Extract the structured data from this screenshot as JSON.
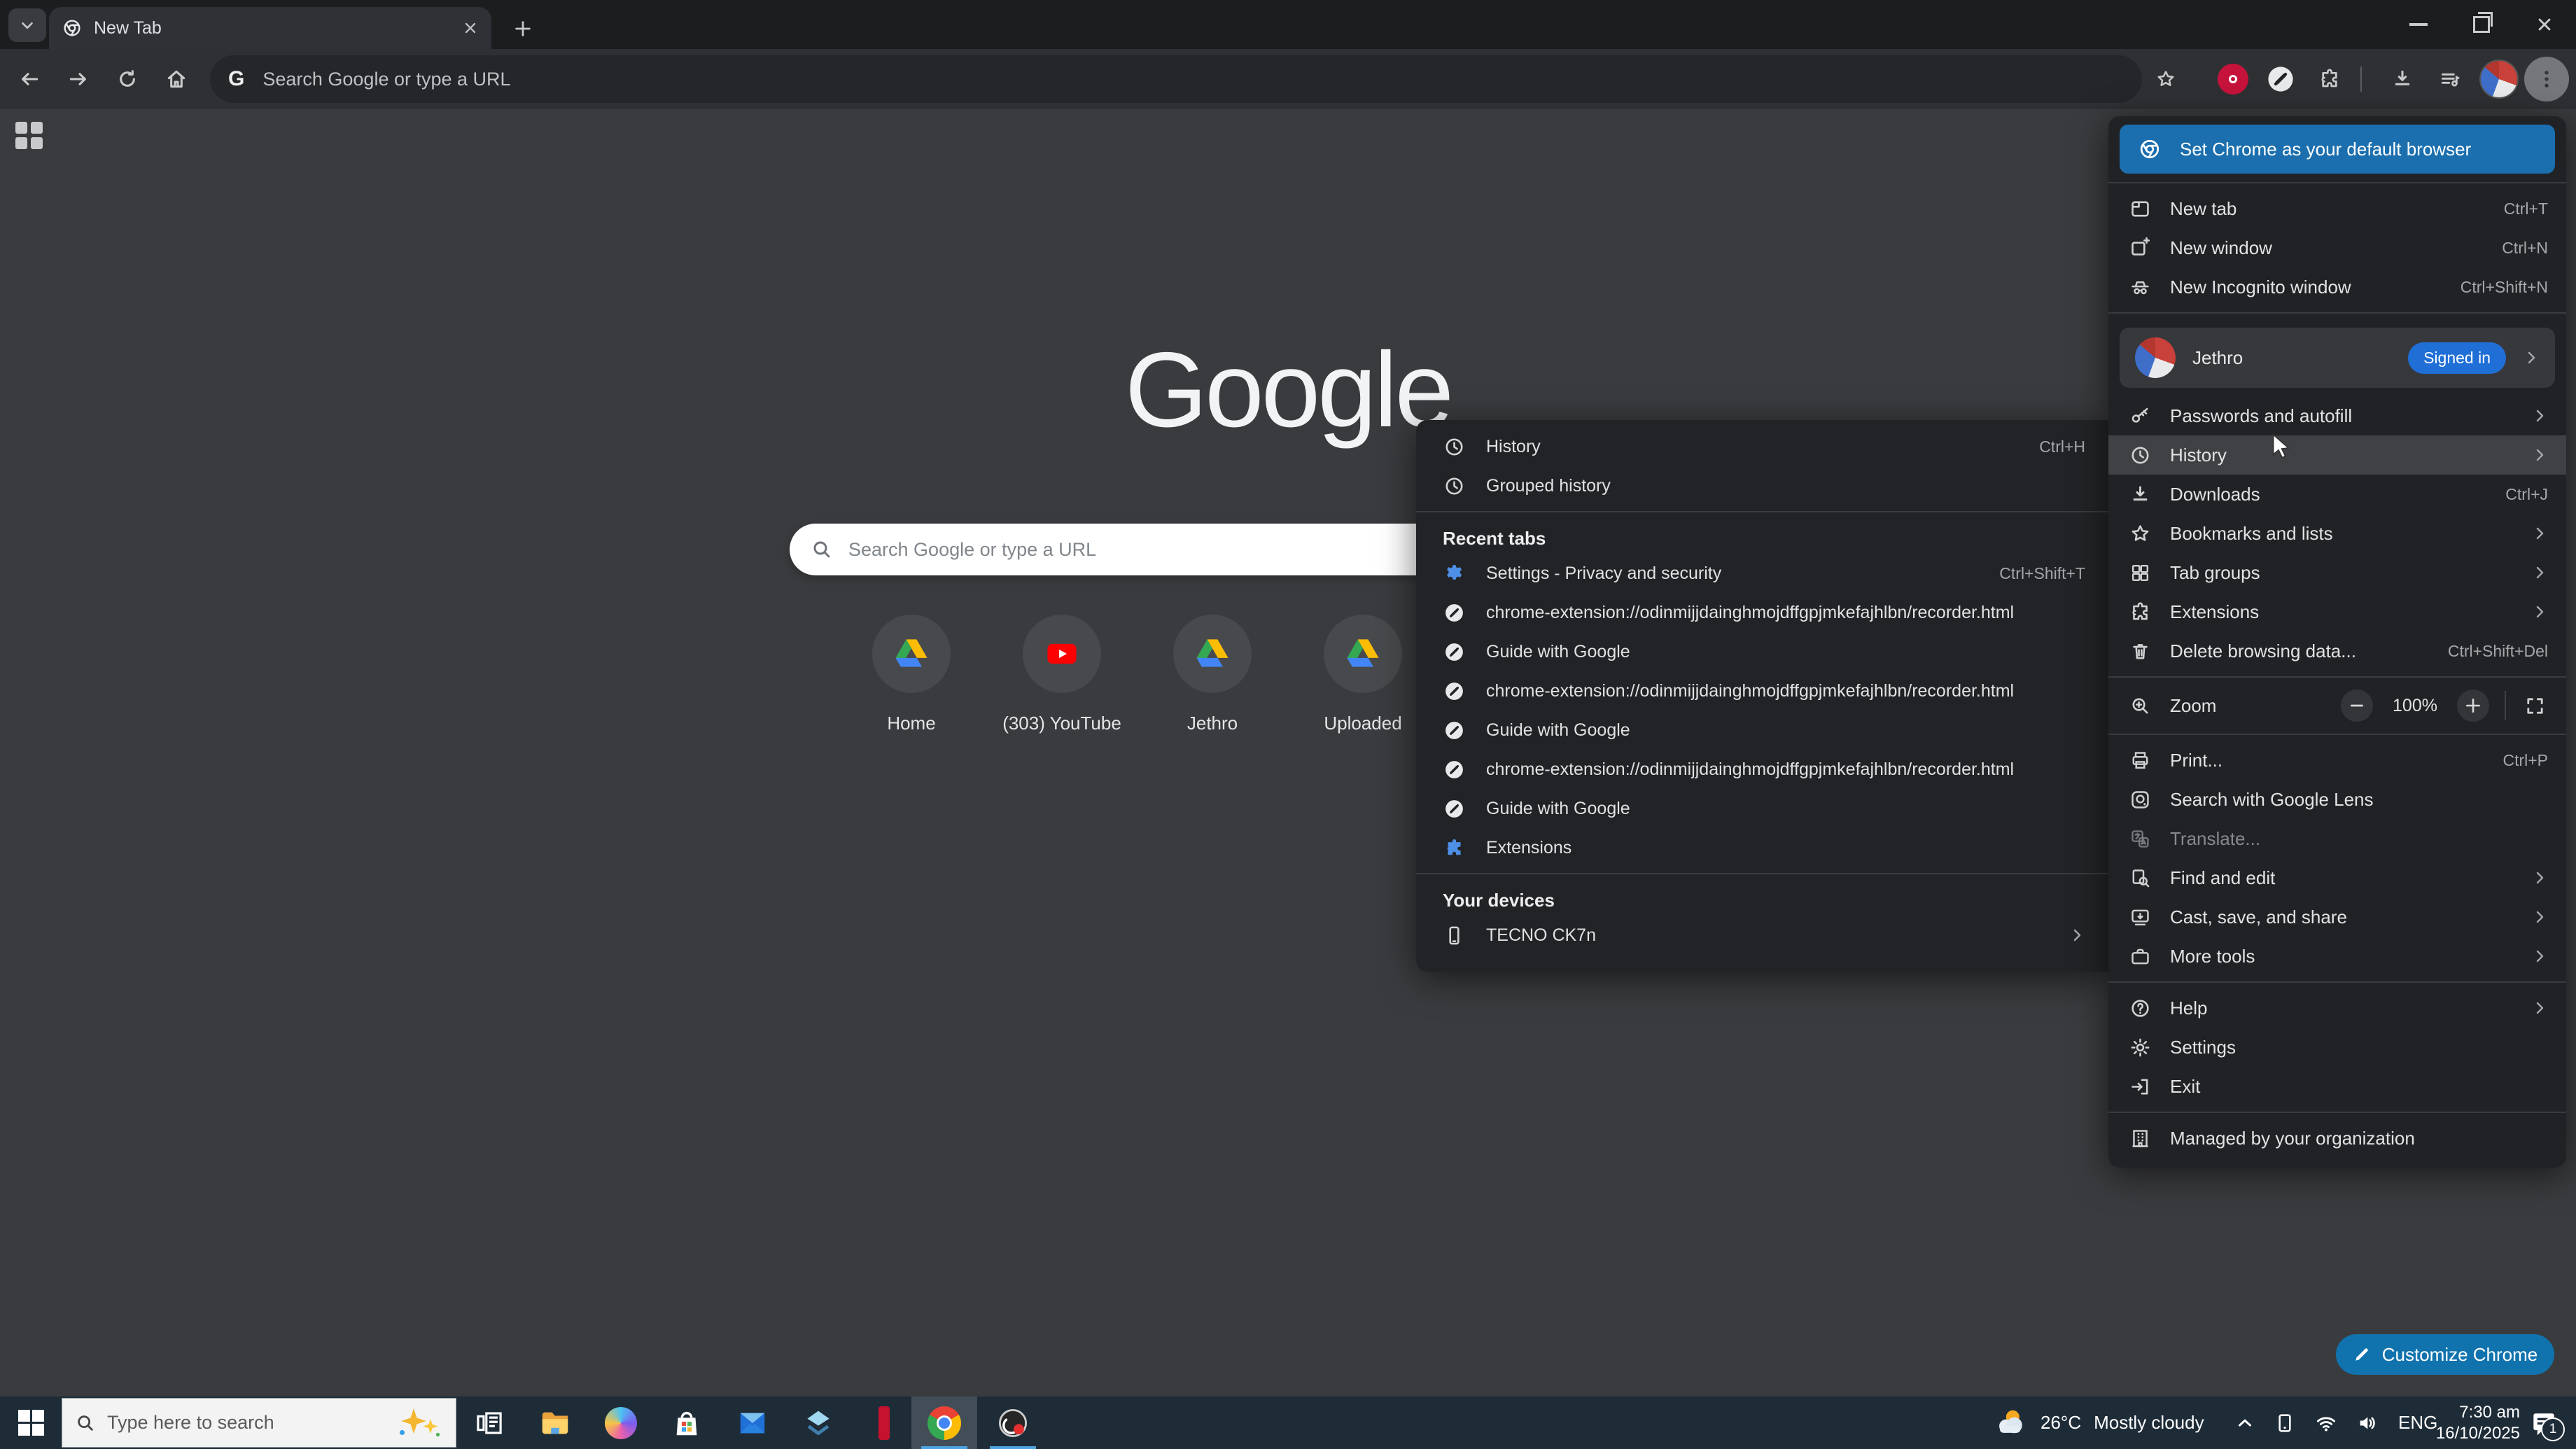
{
  "window": {
    "tab_title": "New Tab"
  },
  "toolbar": {
    "g_badge": "G",
    "url_placeholder": "Search Google or type a URL"
  },
  "page": {
    "logo": "Google",
    "search_placeholder": "Search Google or type a URL",
    "shortcuts": [
      {
        "label": "Home"
      },
      {
        "label": "(303) YouTube"
      },
      {
        "label": "Jethro"
      },
      {
        "label": "Uploaded"
      }
    ],
    "customize_label": "Customize Chrome"
  },
  "menu": {
    "default_banner": "Set Chrome as your default browser",
    "new_tab": {
      "label": "New tab",
      "shortcut": "Ctrl+T"
    },
    "new_window": {
      "label": "New window",
      "shortcut": "Ctrl+N"
    },
    "incognito": {
      "label": "New Incognito window",
      "shortcut": "Ctrl+Shift+N"
    },
    "profile": {
      "name": "Jethro",
      "badge": "Signed in"
    },
    "passwords": {
      "label": "Passwords and autofill"
    },
    "history": {
      "label": "History"
    },
    "downloads": {
      "label": "Downloads",
      "shortcut": "Ctrl+J"
    },
    "bookmarks": {
      "label": "Bookmarks and lists"
    },
    "tab_groups": {
      "label": "Tab groups"
    },
    "extensions": {
      "label": "Extensions"
    },
    "delete_data": {
      "label": "Delete browsing data...",
      "shortcut": "Ctrl+Shift+Del"
    },
    "zoom": {
      "label": "Zoom",
      "value": "100%"
    },
    "print": {
      "label": "Print...",
      "shortcut": "Ctrl+P"
    },
    "lens": {
      "label": "Search with Google Lens"
    },
    "translate": {
      "label": "Translate..."
    },
    "find_edit": {
      "label": "Find and edit"
    },
    "cast": {
      "label": "Cast, save, and share"
    },
    "more_tools": {
      "label": "More tools"
    },
    "help": {
      "label": "Help"
    },
    "settings": {
      "label": "Settings"
    },
    "exit": {
      "label": "Exit"
    },
    "managed": {
      "label": "Managed by your organization"
    }
  },
  "submenu": {
    "history": {
      "label": "History",
      "shortcut": "Ctrl+H"
    },
    "grouped": {
      "label": "Grouped history"
    },
    "recent_header": "Recent tabs",
    "recent": [
      {
        "label": "Settings - Privacy and security",
        "shortcut": "Ctrl+Shift+T"
      },
      {
        "label": "chrome-extension://odinmijjdainghmojdffgpjmkefajhlbn/recorder.html"
      },
      {
        "label": "Guide with Google"
      },
      {
        "label": "chrome-extension://odinmijjdainghmojdffgpjmkefajhlbn/recorder.html"
      },
      {
        "label": "Guide with Google"
      },
      {
        "label": "chrome-extension://odinmijjdainghmojdffgpjmkefajhlbn/recorder.html"
      },
      {
        "label": "Guide with Google"
      },
      {
        "label": "Extensions"
      }
    ],
    "devices_header": "Your devices",
    "device": {
      "label": "TECNO CK7n"
    }
  },
  "taskbar": {
    "search_placeholder": "Type here to search",
    "weather": {
      "temp": "26°C",
      "condition": "Mostly cloudy"
    },
    "tray": {
      "lang": "ENG",
      "time": "7:30 am",
      "date": "16/10/2025",
      "badge": "1"
    }
  },
  "colors": {
    "banner_blue": "#1b6fae",
    "signed_in_blue": "#1f6fd6",
    "customize_blue": "#1173ad",
    "taskbar_underline": "#4da3e0"
  }
}
